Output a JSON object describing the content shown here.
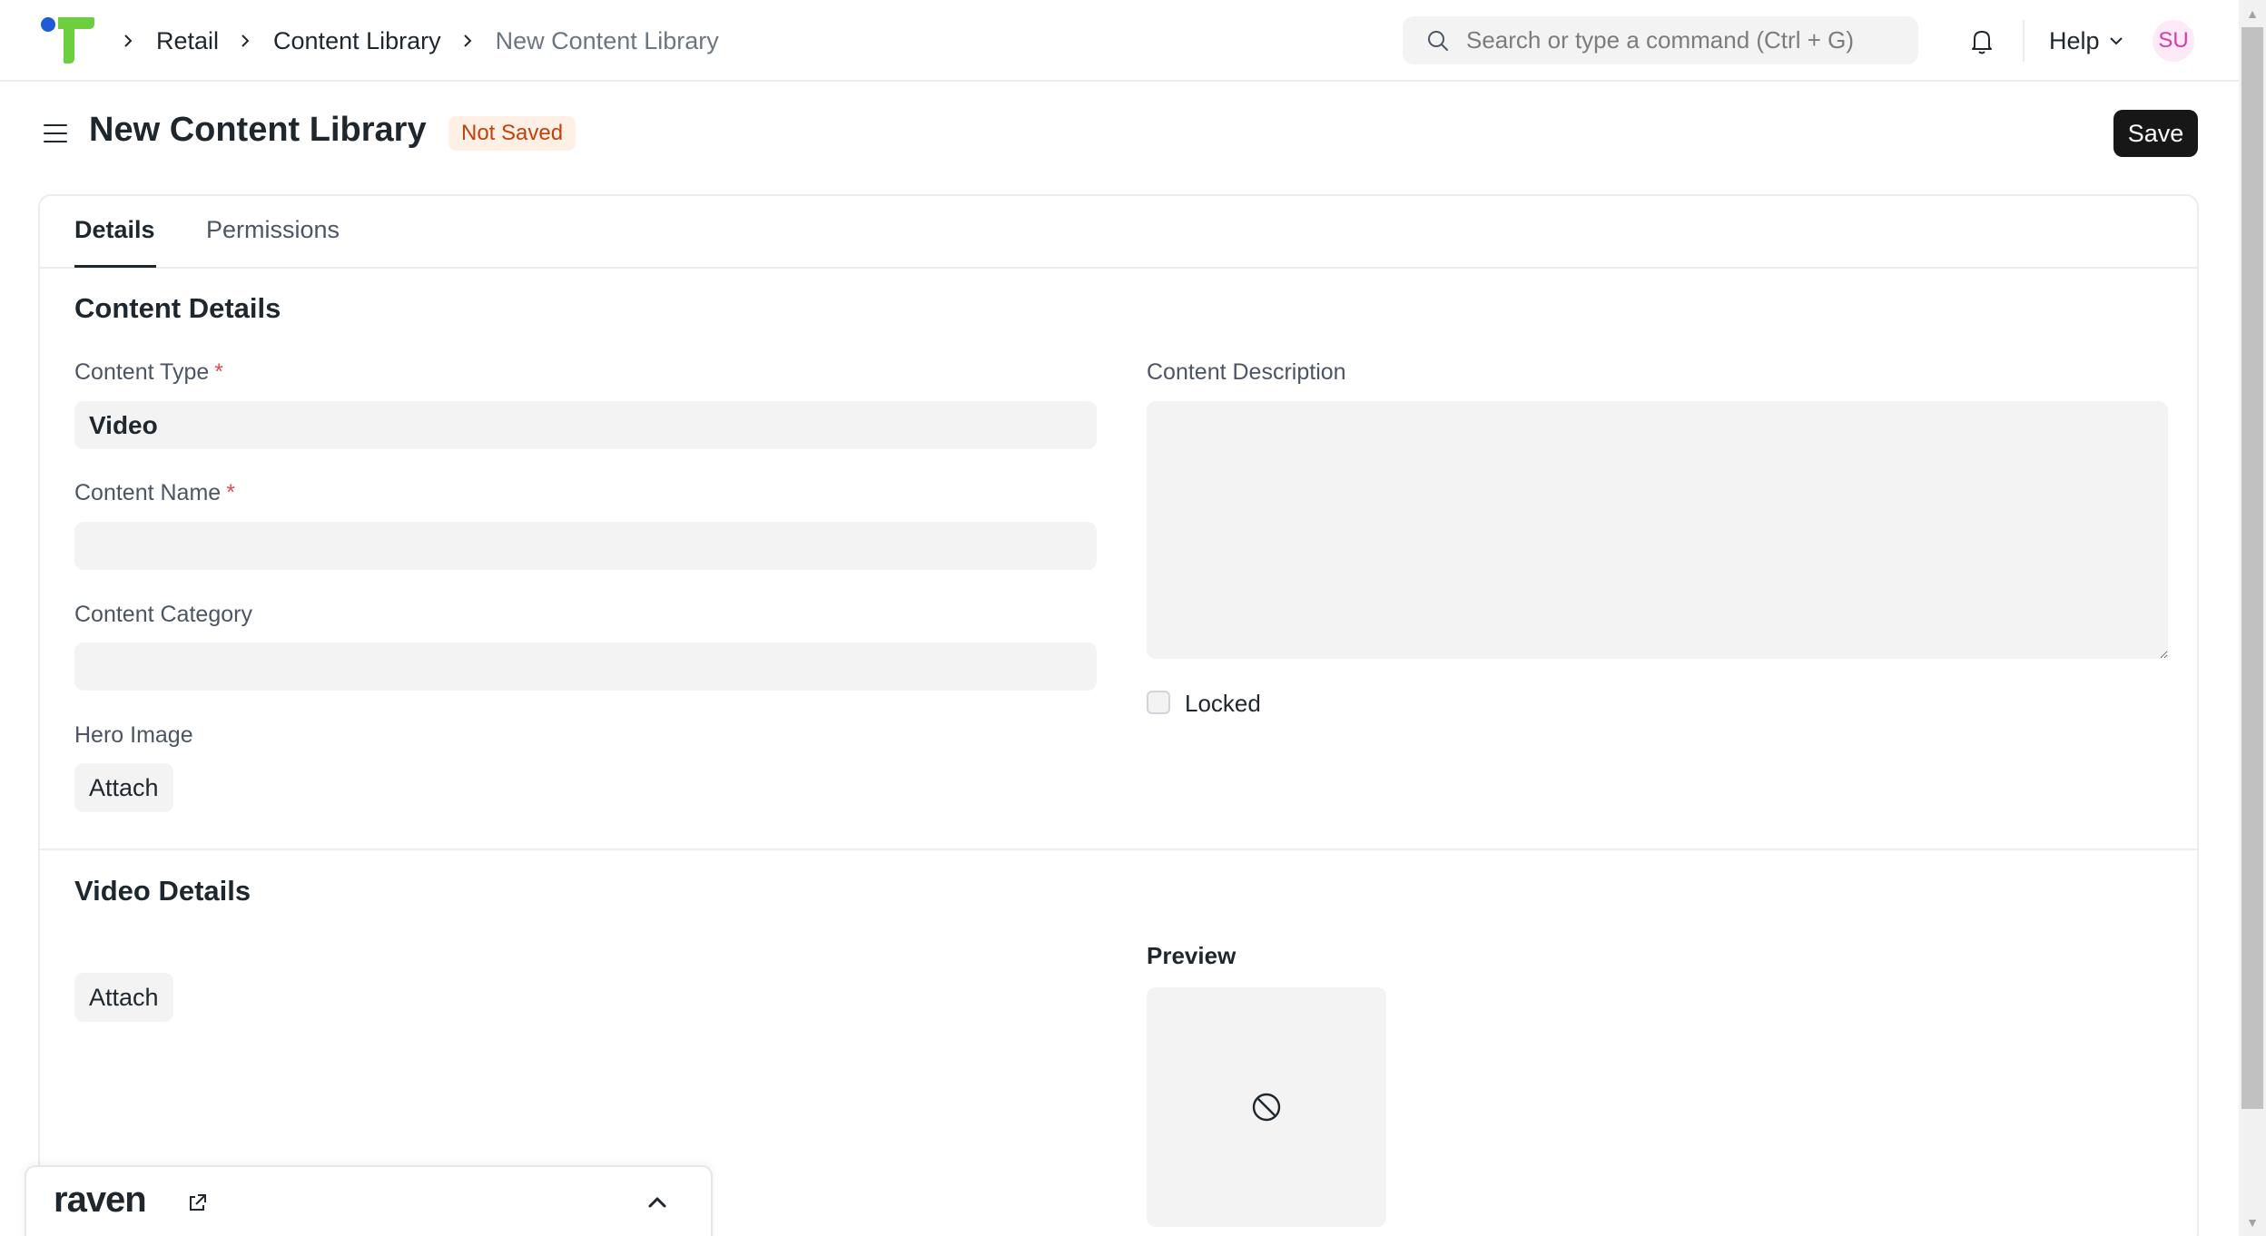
{
  "navbar": {
    "breadcrumbs": [
      "Retail",
      "Content Library",
      "New Content Library"
    ],
    "search_placeholder": "Search or type a command (Ctrl + G)",
    "help_label": "Help",
    "avatar_initials": "SU"
  },
  "page": {
    "title": "New Content Library",
    "status": "Not Saved",
    "save_label": "Save"
  },
  "tabs": [
    {
      "label": "Details",
      "active": true
    },
    {
      "label": "Permissions",
      "active": false
    }
  ],
  "content_details": {
    "title": "Content Details",
    "content_type": {
      "label": "Content Type",
      "value": "Video",
      "required": "*"
    },
    "content_name": {
      "label": "Content Name",
      "value": "",
      "required": "*"
    },
    "content_category": {
      "label": "Content Category",
      "value": ""
    },
    "hero_image": {
      "label": "Hero Image",
      "button": "Attach"
    },
    "content_description": {
      "label": "Content Description",
      "value": ""
    },
    "locked": {
      "label": "Locked",
      "checked": false
    }
  },
  "video_details": {
    "title": "Video Details",
    "attach_button": "Attach",
    "preview_label": "Preview"
  },
  "raven": {
    "brand": "raven"
  },
  "colors": {
    "accent": "#171717",
    "status_bg": "#fff0e6",
    "status_text": "#c2410c",
    "required": "#e24c4c",
    "avatar_text": "#d63dab",
    "field_bg": "#f3f3f3"
  },
  "icons": [
    "app-logo-icon",
    "chevron-right-icon",
    "search-icon",
    "bell-icon",
    "chevron-down-icon",
    "hamburger-icon",
    "prohibited-icon",
    "external-link-icon",
    "chevron-up-icon"
  ]
}
